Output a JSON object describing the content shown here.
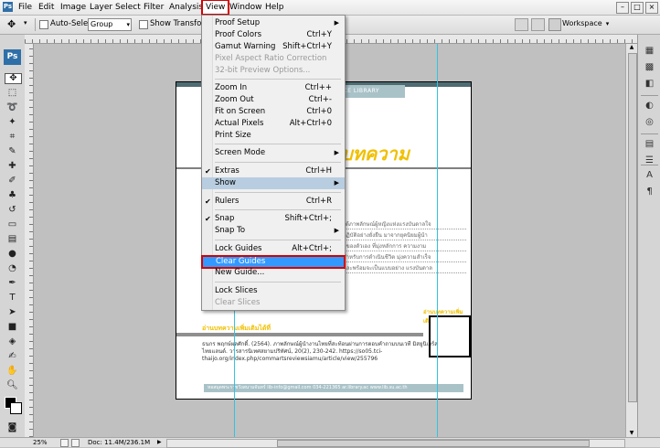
{
  "menubar": {
    "logo": "Ps",
    "items": [
      "File",
      "Edit",
      "Image",
      "Layer",
      "Select",
      "Filter",
      "Analysis",
      "View",
      "Window",
      "Help"
    ]
  },
  "options": {
    "auto_select_label": "Auto-Select",
    "auto_select_value": "Group",
    "show_transform_label": "Show Transform C",
    "workspace_label": "Workspace"
  },
  "toolbar": {
    "logo": "Ps"
  },
  "view_menu": {
    "items": [
      {
        "label": "Proof Setup",
        "shortcut": "",
        "submenu": true,
        "disabled": false,
        "checked": false
      },
      {
        "label": "Proof Colors",
        "shortcut": "Ctrl+Y",
        "submenu": false,
        "disabled": false,
        "checked": false
      },
      {
        "label": "Gamut Warning",
        "shortcut": "Shift+Ctrl+Y",
        "submenu": false,
        "disabled": false,
        "checked": false
      },
      {
        "label": "Pixel Aspect Ratio Correction",
        "shortcut": "",
        "submenu": false,
        "disabled": true,
        "checked": false
      },
      {
        "label": "32-bit Preview Options...",
        "shortcut": "",
        "submenu": false,
        "disabled": true,
        "checked": false
      },
      {
        "label": "Zoom In",
        "shortcut": "Ctrl++",
        "submenu": false,
        "disabled": false,
        "checked": false
      },
      {
        "label": "Zoom Out",
        "shortcut": "Ctrl+-",
        "submenu": false,
        "disabled": false,
        "checked": false
      },
      {
        "label": "Fit on Screen",
        "shortcut": "Ctrl+0",
        "submenu": false,
        "disabled": false,
        "checked": false
      },
      {
        "label": "Actual Pixels",
        "shortcut": "Alt+Ctrl+0",
        "submenu": false,
        "disabled": false,
        "checked": false
      },
      {
        "label": "Print Size",
        "shortcut": "",
        "submenu": false,
        "disabled": false,
        "checked": false
      },
      {
        "label": "Screen Mode",
        "shortcut": "",
        "submenu": true,
        "disabled": false,
        "checked": false
      },
      {
        "label": "Extras",
        "shortcut": "Ctrl+H",
        "submenu": false,
        "disabled": false,
        "checked": true
      },
      {
        "label": "Show",
        "shortcut": "",
        "submenu": true,
        "disabled": false,
        "checked": false
      },
      {
        "label": "Rulers",
        "shortcut": "Ctrl+R",
        "submenu": false,
        "disabled": false,
        "checked": true
      },
      {
        "label": "Snap",
        "shortcut": "Shift+Ctrl+;",
        "submenu": false,
        "disabled": false,
        "checked": true
      },
      {
        "label": "Snap To",
        "shortcut": "",
        "submenu": true,
        "disabled": false,
        "checked": false
      },
      {
        "label": "Lock Guides",
        "shortcut": "Alt+Ctrl+;",
        "submenu": false,
        "disabled": false,
        "checked": false
      },
      {
        "label": "Clear Guides",
        "shortcut": "",
        "submenu": false,
        "disabled": false,
        "checked": false
      },
      {
        "label": "New Guide...",
        "shortcut": "",
        "submenu": false,
        "disabled": false,
        "checked": false
      },
      {
        "label": "Lock Slices",
        "shortcut": "",
        "submenu": false,
        "disabled": false,
        "checked": false
      },
      {
        "label": "Clear Slices",
        "shortcut": "",
        "submenu": false,
        "disabled": true,
        "checked": false
      }
    ]
  },
  "document": {
    "header_banner": "ACE LIBRARY",
    "header_mark": "IB",
    "article_title": "บทความ",
    "body_lines": [
      "ได้ภาพลักษณ์ผู้หญิงแห่งแรงบันดาลใจ",
      "กฏิบัติอย่างยั่งยืน มาจากยุคนิยมผู้นำ",
      "อของตัวเอง ที่มุ่งหลักการ ความงาม",
      "สำหรับการดำเนินชีวิต มุ่งความสำเร็จ",
      "และพร้อมจะเป็นแบบอย่าง แรงบันดาล"
    ],
    "more_left": "อ่านบทความเพิ่มเติมได้ที่",
    "more_right": "อ่านบทความเพิ่มเติม",
    "reference": "ธนกร พฤกษ์ผลศักดิ์. (2564). ภาพลักษณ์ผู้นำงานไทยที่สะท้อนผ่านการตอบคำถามบนเวที มิสยูนิเวิร์สไทยแลนด์. วารสารนิเทศสยามปริทัศน์, 20(2), 230-242. https://so05.tci-thaijo.org/index.php/commartsreviewsiamu/article/view/255796",
    "footer": "หอสมุดพระราชวังสนามจันทร์    lib-info@gmail.com    034-221365    ar.library.ac    www.lib.su.ac.th"
  },
  "status": {
    "zoom": "25%",
    "doc_info": "Doc: 11.4M/236.1M"
  }
}
